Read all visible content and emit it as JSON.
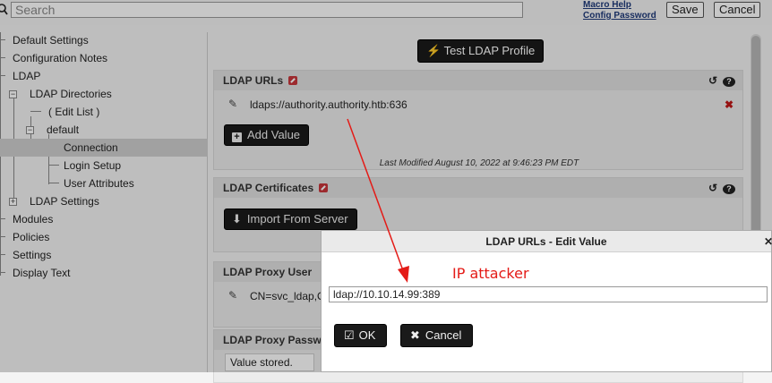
{
  "topbar": {
    "search_placeholder": "Search",
    "macro_help": "Macro Help",
    "config_password": "Config Password",
    "save_label": "Save",
    "cancel_label": "Cancel"
  },
  "sidebar": {
    "items": [
      {
        "label": "Default Settings"
      },
      {
        "label": "Configuration Notes"
      },
      {
        "label": "LDAP"
      },
      {
        "label": "LDAP Directories"
      },
      {
        "label": "( Edit List )"
      },
      {
        "label": "default"
      },
      {
        "label": "Connection"
      },
      {
        "label": "Login Setup"
      },
      {
        "label": "User Attributes"
      },
      {
        "label": "LDAP Settings"
      },
      {
        "label": "Modules"
      },
      {
        "label": "Policies"
      },
      {
        "label": "Settings"
      },
      {
        "label": "Display Text"
      }
    ]
  },
  "main": {
    "test_button_label": "Test LDAP Profile",
    "panels": {
      "ldap_urls": {
        "title": "LDAP URLs",
        "url_value": "ldaps://authority.authority.htb:636",
        "add_label": "Add Value",
        "last_modified": "Last Modified August 10, 2022 at 9:46:23 PM EDT"
      },
      "ldap_certs": {
        "title": "LDAP Certificates",
        "import_label": "Import From Server"
      },
      "ldap_proxy_user": {
        "title": "LDAP Proxy User",
        "value": "CN=svc_ldap,O"
      },
      "ldap_proxy_pass": {
        "title": "LDAP Proxy Passw",
        "value": "Value stored."
      }
    }
  },
  "dialog": {
    "title": "LDAP URLs - Edit Value",
    "input_value": "ldap://10.10.14.99:389",
    "ok_label": "OK",
    "cancel_label": "Cancel"
  },
  "annotation": {
    "text": "IP attacker",
    "color": "#e41b17"
  },
  "colors": {
    "dark_button": "#1a1a1a",
    "edit_tag": "#c8373b",
    "delete": "#c01818"
  }
}
